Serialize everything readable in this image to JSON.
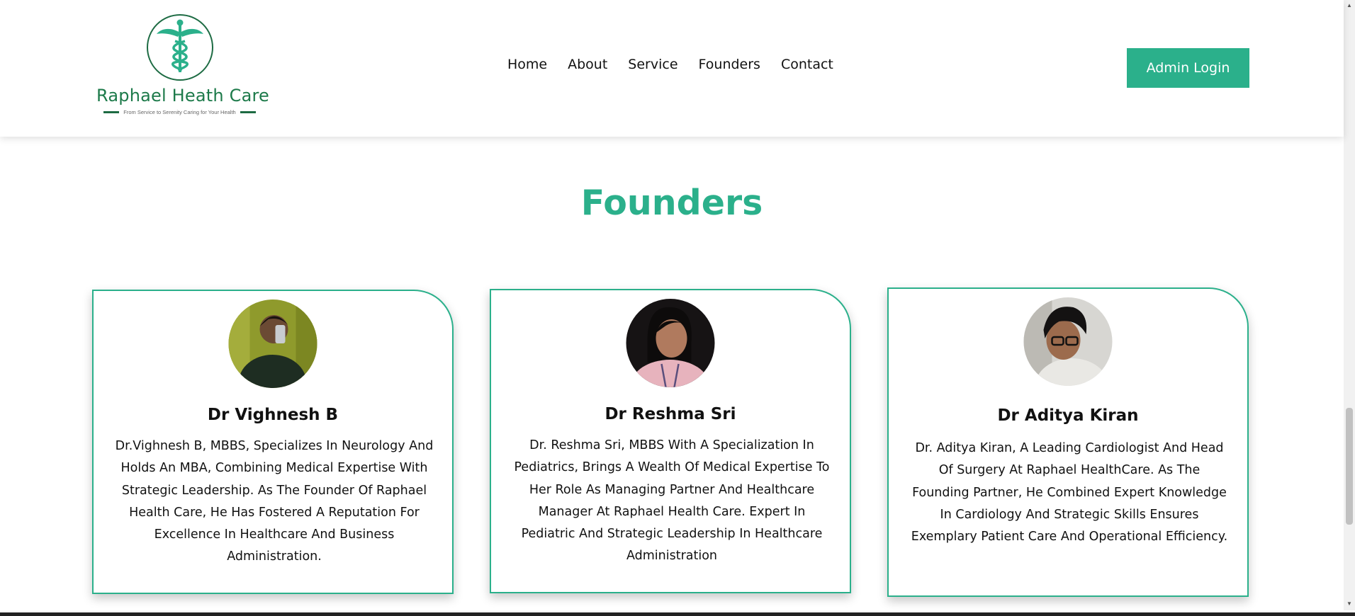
{
  "header": {
    "logo": {
      "name": "Raphael Heath Care",
      "tagline": "From Service to Serenity Caring for Your Health",
      "emblem_icon": "caduceus-icon"
    },
    "nav": [
      "Home",
      "About",
      "Service",
      "Founders",
      "Contact"
    ],
    "admin_button": "Admin Login"
  },
  "section": {
    "title": "Founders"
  },
  "founders": [
    {
      "name": "Dr Vighnesh B",
      "bio": "Dr.Vighnesh B, MBBS, Specializes In Neurology And Holds An MBA, Combining Medical Expertise With Strategic Leadership. As The Founder Of Raphael Health Care, He Has Fostered A Reputation For Excellence In Healthcare And Business Administration."
    },
    {
      "name": "Dr Reshma Sri",
      "bio": "Dr. Reshma Sri, MBBS With A Specialization In Pediatrics, Brings A Wealth Of Medical Expertise To Her Role As Managing Partner And Healthcare Manager At Raphael Health Care. Expert In Pediatric And Strategic Leadership In Healthcare Administration"
    },
    {
      "name": "Dr Aditya Kiran",
      "bio": "Dr. Aditya Kiran, A Leading Cardiologist And Head Of Surgery At Raphael HealthCare. As The Founding Partner, He Combined Expert Knowledge In Cardiology And Strategic Skills Ensures Exemplary Patient Care And Operational Efficiency."
    }
  ],
  "colors": {
    "accent": "#2bb08b",
    "logo_green": "#1d6b43"
  }
}
